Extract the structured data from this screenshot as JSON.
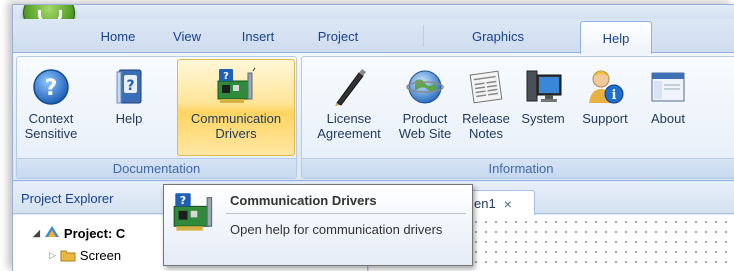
{
  "ribbon": {
    "tabs": [
      {
        "label": "Home"
      },
      {
        "label": "View"
      },
      {
        "label": "Insert"
      },
      {
        "label": "Project"
      },
      {
        "label": "Graphics"
      },
      {
        "label": "Help",
        "active": true
      }
    ],
    "groups": {
      "documentation": {
        "label": "Documentation",
        "buttons": [
          {
            "line1": "Context",
            "line2": "Sensitive",
            "icon": "context-help-icon"
          },
          {
            "line1": "Help",
            "line2": "",
            "icon": "help-book-icon"
          },
          {
            "line1": "Communication",
            "line2": "Drivers",
            "icon": "network-card-icon"
          }
        ]
      },
      "information": {
        "label": "Information",
        "buttons": [
          {
            "line1": "License",
            "line2": "Agreement",
            "icon": "pen-icon"
          },
          {
            "line1": "Product",
            "line2": "Web Site",
            "icon": "globe-icon"
          },
          {
            "line1": "Release",
            "line2": "Notes",
            "icon": "newspaper-icon"
          },
          {
            "line1": "System",
            "line2": "",
            "icon": "computer-icon"
          },
          {
            "line1": "Support",
            "line2": "",
            "icon": "support-person-icon"
          },
          {
            "line1": "About",
            "line2": "",
            "icon": "window-icon"
          }
        ]
      }
    }
  },
  "project_explorer": {
    "title": "Project Explorer",
    "tree": [
      {
        "label": "Project: C",
        "icon": "project-icon"
      },
      {
        "label": "Screen",
        "icon": "folder-icon"
      }
    ]
  },
  "document_tab": {
    "label": "en1",
    "close": "×"
  },
  "tooltip": {
    "title": "Communication Drivers",
    "body": "Open help for communication drivers"
  },
  "colors": {
    "accent": "#15428b",
    "hover_gold": "#ffd461",
    "ribbon_bg": "#e4edf8"
  }
}
